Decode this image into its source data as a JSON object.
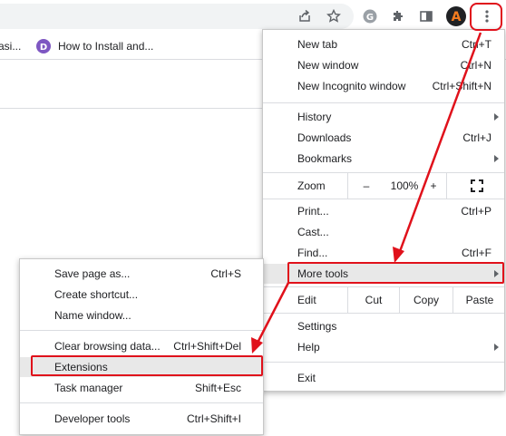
{
  "toolbar": {
    "icons": [
      "share-icon",
      "star-icon",
      "google-extension-icon",
      "puzzle-extensions-icon",
      "side-panel-icon",
      "profile-avatar",
      "kebab-menu-icon"
    ],
    "avatar_letter": "A"
  },
  "bookmarks": {
    "items": [
      {
        "label": "asi..."
      },
      {
        "label": "How to Install and..."
      }
    ]
  },
  "main_menu": {
    "new_tab": {
      "label": "New tab",
      "shortcut": "Ctrl+T"
    },
    "new_window": {
      "label": "New window",
      "shortcut": "Ctrl+N"
    },
    "new_incognito": {
      "label": "New Incognito window",
      "shortcut": "Ctrl+Shift+N"
    },
    "history": {
      "label": "History"
    },
    "downloads": {
      "label": "Downloads",
      "shortcut": "Ctrl+J"
    },
    "bookmarks": {
      "label": "Bookmarks"
    },
    "zoom": {
      "label": "Zoom",
      "minus": "–",
      "value": "100%",
      "plus": "+"
    },
    "print": {
      "label": "Print...",
      "shortcut": "Ctrl+P"
    },
    "cast": {
      "label": "Cast..."
    },
    "find": {
      "label": "Find...",
      "shortcut": "Ctrl+F"
    },
    "more_tools": {
      "label": "More tools"
    },
    "edit": {
      "label": "Edit",
      "cut": "Cut",
      "copy": "Copy",
      "paste": "Paste"
    },
    "settings": {
      "label": "Settings"
    },
    "help": {
      "label": "Help"
    },
    "exit": {
      "label": "Exit"
    }
  },
  "submenu": {
    "save_page": {
      "label": "Save page as...",
      "shortcut": "Ctrl+S"
    },
    "create_shortcut": {
      "label": "Create shortcut..."
    },
    "name_window": {
      "label": "Name window..."
    },
    "clear_browsing": {
      "label": "Clear browsing data...",
      "shortcut": "Ctrl+Shift+Del"
    },
    "extensions": {
      "label": "Extensions"
    },
    "task_manager": {
      "label": "Task manager",
      "shortcut": "Shift+Esc"
    },
    "developer_tools": {
      "label": "Developer tools",
      "shortcut": "Ctrl+Shift+I"
    }
  },
  "colors": {
    "annotation": "#e0111b",
    "highlight": "#e8e8e8",
    "avatar_bg": "#202124",
    "avatar_fg": "#f57c1f",
    "bookmark_icon": "#7e57c2"
  }
}
